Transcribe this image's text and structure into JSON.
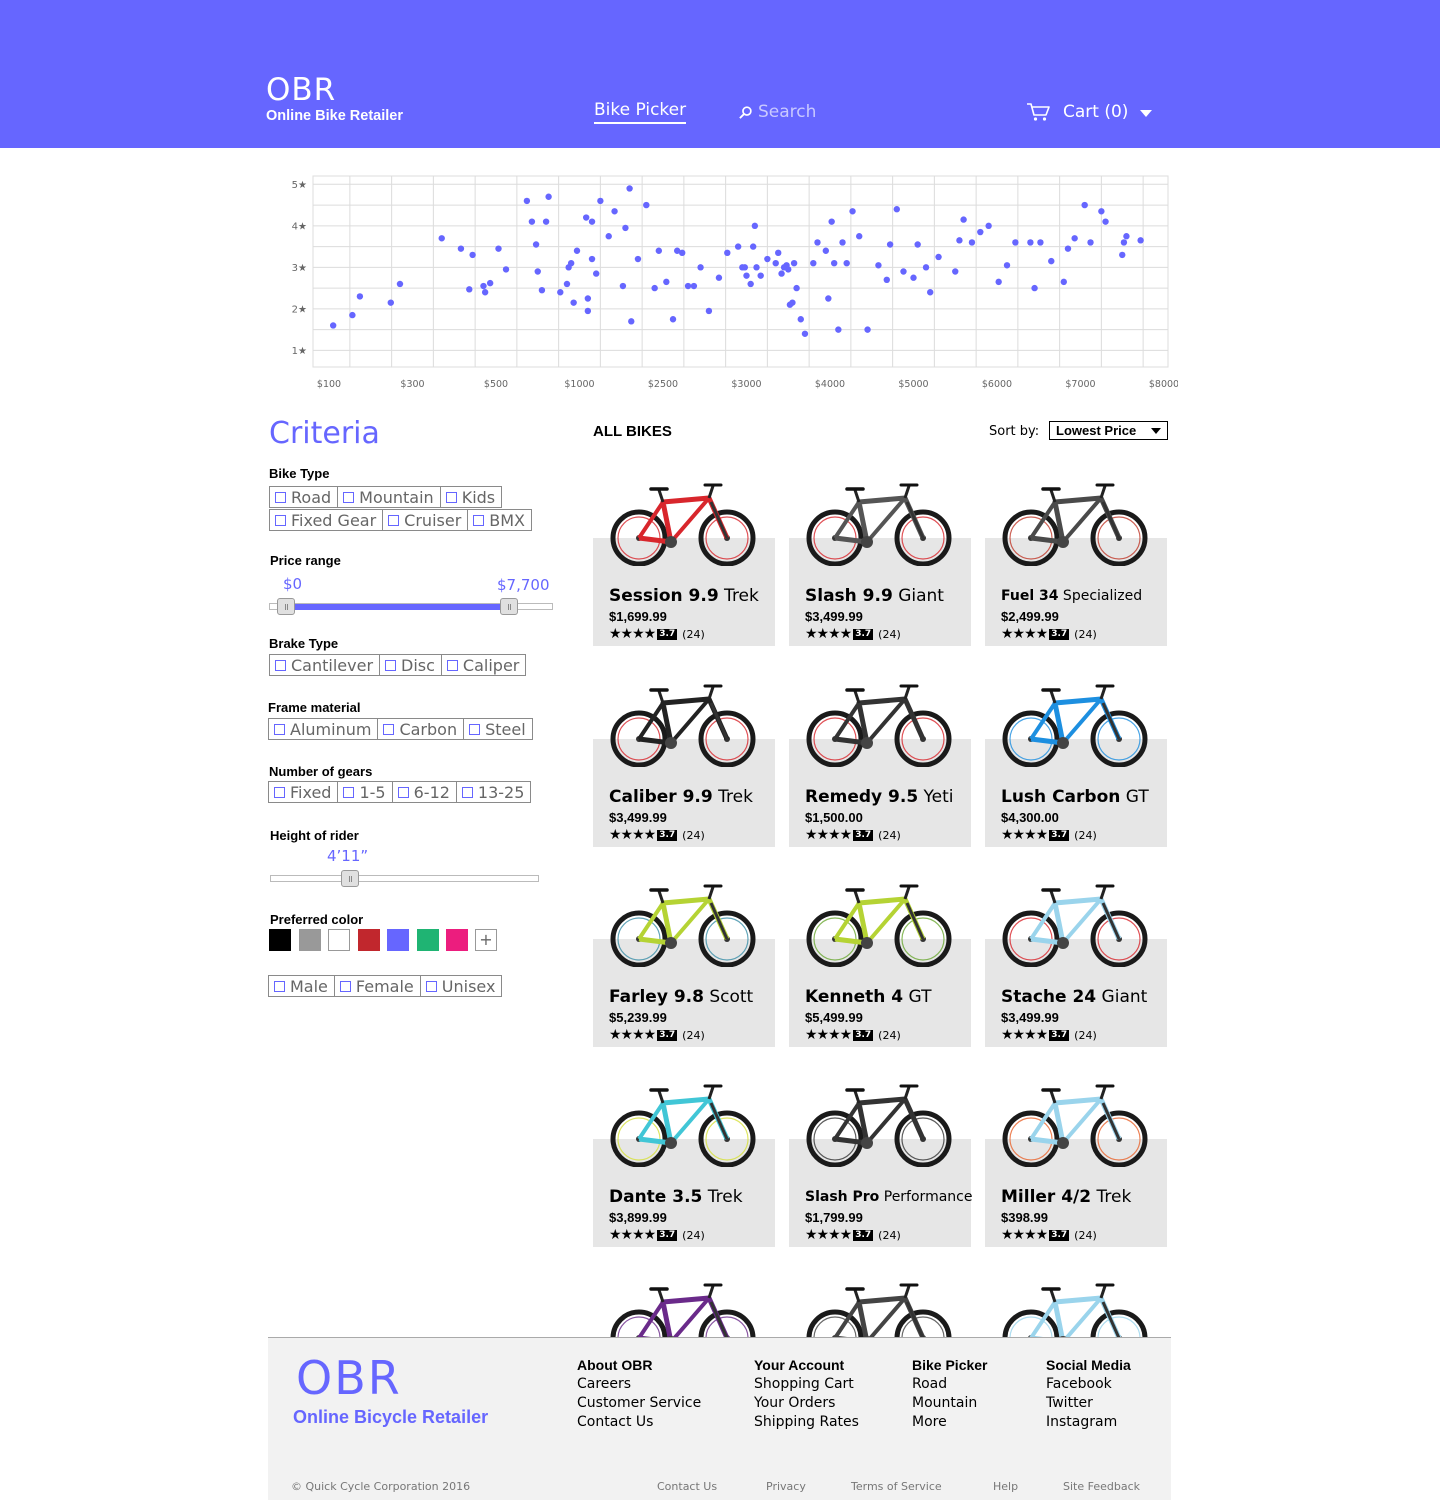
{
  "header": {
    "logo_big": "OBR",
    "logo_small": "Online Bike Retailer",
    "nav_link": "Bike Picker",
    "search_placeholder": "Search",
    "cart_label": "Cart (0)"
  },
  "colors": {
    "brand": "#6666ff",
    "card_bg": "#e6e6e6",
    "footer_bg": "#f2f2f2"
  },
  "chart_data": {
    "type": "scatter",
    "title": "",
    "xlabel": "",
    "ylabel": "",
    "x_tick_labels": [
      "$100",
      "$300",
      "$500",
      "$1000",
      "$2500",
      "$3000",
      "$4000",
      "$5000",
      "$6000",
      "$7000",
      "$8000"
    ],
    "y_tick_labels": [
      "1★",
      "2★",
      "3★",
      "4★",
      "5★"
    ],
    "ylim": [
      0.6,
      5.2
    ],
    "x_position_scale": "categorical-nonuniform (ticks evenly spaced)",
    "grid": true,
    "points_x_tick_index": [
      0.05,
      0.28,
      0.37,
      0.74,
      0.85,
      1.35,
      1.58,
      1.68,
      1.72,
      1.85,
      1.87,
      1.93,
      2.03,
      2.12,
      2.37,
      2.43,
      2.48,
      2.5,
      2.55,
      2.6,
      2.63,
      2.77,
      2.85,
      2.87,
      2.9,
      2.93,
      2.97,
      3.08,
      3.1,
      3.1,
      3.15,
      3.15,
      3.2,
      3.25,
      3.35,
      3.42,
      3.52,
      3.55,
      3.6,
      3.62,
      3.7,
      3.8,
      3.9,
      3.95,
      4.04,
      4.12,
      4.17,
      4.23,
      4.3,
      4.37,
      4.45,
      4.55,
      4.67,
      4.77,
      4.9,
      4.95,
      4.98,
      5.0,
      5.05,
      5.08,
      5.1,
      5.12,
      5.17,
      5.25,
      5.35,
      5.38,
      5.42,
      5.45,
      5.48,
      5.5,
      5.52,
      5.55,
      5.57,
      5.6,
      5.65,
      5.7,
      5.8,
      5.85,
      5.95,
      5.98,
      6.02,
      6.05,
      6.1,
      6.15,
      6.2,
      6.27,
      6.35,
      6.45,
      6.58,
      6.68,
      6.72,
      6.8,
      6.88,
      7.0,
      7.05,
      7.15,
      7.2,
      7.3,
      7.5,
      7.55,
      7.6,
      7.7,
      7.8,
      7.9,
      8.02,
      8.12,
      8.22,
      8.4,
      8.45,
      8.52,
      8.65,
      8.8,
      8.85,
      8.93,
      9.05,
      9.12,
      9.25,
      9.3,
      9.5,
      9.52,
      9.55,
      9.72
    ],
    "points_y": [
      1.6,
      1.85,
      2.3,
      2.15,
      2.6,
      3.7,
      3.45,
      2.47,
      3.3,
      2.55,
      2.4,
      2.62,
      3.45,
      2.95,
      4.6,
      4.1,
      3.55,
      2.9,
      2.45,
      4.1,
      4.7,
      2.4,
      2.6,
      3.0,
      3.1,
      2.15,
      3.4,
      4.2,
      2.25,
      1.95,
      4.1,
      3.2,
      2.85,
      4.6,
      3.75,
      4.35,
      2.55,
      3.95,
      4.9,
      1.7,
      3.2,
      4.5,
      2.5,
      3.4,
      2.65,
      1.75,
      3.4,
      3.35,
      2.55,
      2.55,
      3.0,
      1.95,
      2.75,
      3.35,
      3.5,
      3.0,
      3.0,
      2.8,
      2.6,
      3.5,
      4.0,
      3.0,
      2.8,
      3.2,
      3.1,
      3.35,
      2.85,
      3.0,
      3.05,
      2.95,
      2.1,
      2.15,
      3.1,
      2.5,
      1.75,
      1.4,
      3.1,
      3.6,
      3.4,
      2.25,
      4.1,
      3.1,
      1.5,
      3.6,
      3.1,
      4.35,
      3.75,
      1.5,
      3.05,
      2.7,
      3.55,
      4.4,
      2.9,
      2.75,
      3.55,
      3.0,
      2.4,
      3.25,
      2.9,
      3.65,
      4.15,
      3.6,
      3.85,
      4.0,
      2.65,
      3.05,
      3.6,
      3.6,
      2.5,
      3.6,
      3.15,
      2.65,
      3.45,
      3.7,
      4.5,
      3.6,
      4.35,
      4.1,
      3.3,
      3.6,
      3.75,
      3.65
    ]
  },
  "criteria": {
    "title": "Criteria",
    "bike_type": {
      "label": "Bike Type",
      "row1": [
        "Road",
        "Mountain",
        "Kids"
      ],
      "row2": [
        "Fixed Gear",
        "Cruiser",
        "BMX"
      ]
    },
    "price_range": {
      "label": "Price range",
      "min_label": "$0",
      "max_label": "$7,700",
      "min_fraction": 0.0,
      "max_fraction": 0.89
    },
    "brake_type": {
      "label": "Brake Type",
      "options": [
        "Cantilever",
        "Disc",
        "Caliper"
      ]
    },
    "frame_material": {
      "label": "Frame material",
      "options": [
        "Aluminum",
        "Carbon",
        "Steel"
      ]
    },
    "gears": {
      "label": "Number of gears",
      "options": [
        "Fixed",
        "1-5",
        "6-12",
        "13-25"
      ]
    },
    "height": {
      "label": "Height of rider",
      "value_label": "4’11”",
      "fraction": 0.27
    },
    "color": {
      "label": "Preferred color",
      "swatches": [
        "#000000",
        "#999999",
        "#ffffff",
        "#c1272d",
        "#6666ff",
        "#1fb473",
        "#ec1d7e"
      ],
      "more": "+"
    },
    "gender": {
      "options": [
        "Male",
        "Female",
        "Unisex"
      ]
    }
  },
  "listing": {
    "title": "ALL BIKES",
    "sort_label": "Sort by:",
    "sort_value": "Lowest Price",
    "rating_badge": "3.7",
    "rating_count": "(24)",
    "rating_stars": "★★★★",
    "cards": [
      {
        "model": "Session 9.9",
        "brand": "Trek",
        "price": "$1,699.99",
        "frame": "#d8262c",
        "accent": "#d8262c"
      },
      {
        "model": "Slash 9.9",
        "brand": "Giant",
        "price": "$3,499.99",
        "frame": "#555555",
        "accent": "#d8262c"
      },
      {
        "model": "Fuel 34",
        "brand": "Specialized",
        "price": "$2,499.99",
        "frame": "#4a4a4a",
        "accent": "#c0392b"
      },
      {
        "model": "Caliber 9.9",
        "brand": "Trek",
        "price": "$3,499.99",
        "frame": "#222222",
        "accent": "#d8262c"
      },
      {
        "model": "Remedy 9.5",
        "brand": "Yeti",
        "price": "$1,500.00",
        "frame": "#333333",
        "accent": "#d8262c"
      },
      {
        "model": "Lush Carbon",
        "brand": "GT",
        "price": "$4,300.00",
        "frame": "#1d8fe0",
        "accent": "#1d8fe0"
      },
      {
        "model": "Farley 9.8",
        "brand": "Scott",
        "price": "$5,239.99",
        "frame": "#b5d334",
        "accent": "#3b8fa8"
      },
      {
        "model": "Kenneth 4",
        "brand": "GT",
        "price": "$5,499.99",
        "frame": "#b5d334",
        "accent": "#6aa832"
      },
      {
        "model": "Stache 24",
        "brand": "Giant",
        "price": "$3,499.99",
        "frame": "#9ad4ec",
        "accent": "#d8262c"
      },
      {
        "model": "Dante 3.5",
        "brand": "Trek",
        "price": "$3,899.99",
        "frame": "#41c6d6",
        "accent": "#d6e03a"
      },
      {
        "model": "Slash Pro",
        "brand": "Performance",
        "price": "$1,799.99",
        "frame": "#333333",
        "accent": "#333333"
      },
      {
        "model": "Miller 4/2",
        "brand": "Trek",
        "price": "$398.99",
        "frame": "#9ad4ec",
        "accent": "#e8632c"
      }
    ],
    "partial_row_frames": [
      "#6a2a8a",
      "#444444",
      "#9ad4ec"
    ]
  },
  "footer": {
    "logo_big": "OBR",
    "logo_small": "Online Bicycle Retailer",
    "columns": [
      {
        "head": "About OBR",
        "links": [
          "Careers",
          "Customer Service",
          "Contact Us"
        ]
      },
      {
        "head": "Your Account",
        "links": [
          "Shopping Cart",
          "Your Orders",
          "Shipping Rates"
        ]
      },
      {
        "head": "Bike Picker",
        "links": [
          "Road",
          "Mountain",
          "More"
        ]
      },
      {
        "head": "Social Media",
        "links": [
          "Facebook",
          "Twitter",
          "Instagram"
        ]
      }
    ],
    "copyright": "© Quick Cycle Corporation 2016",
    "bottom_links": [
      "Contact Us",
      "Privacy",
      "Terms of Service",
      "Help",
      "Site Feedback"
    ]
  }
}
